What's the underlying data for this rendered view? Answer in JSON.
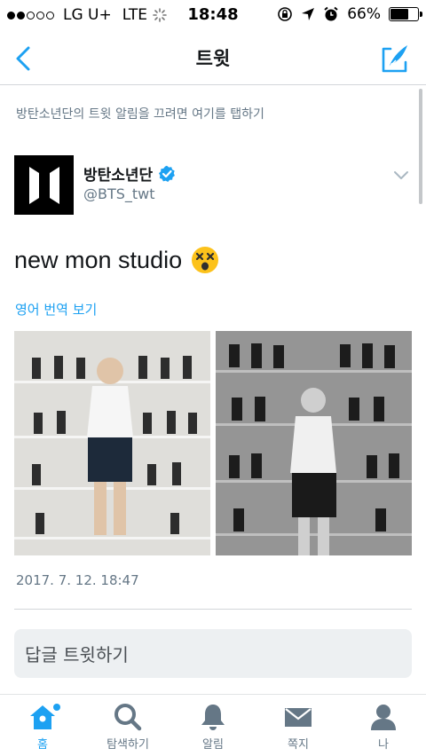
{
  "status_bar": {
    "carrier": "LG U+",
    "network": "LTE",
    "time": "18:48",
    "battery": "66%",
    "battery_level": 0.66,
    "signal_bars_filled": 2
  },
  "nav": {
    "title": "트윗"
  },
  "notification": {
    "text": "방탄소년단의 트윗 알림을 끄려면 여기를 탭하기"
  },
  "tweet": {
    "author_name": "방탄소년단",
    "author_handle": "@BTS_twt",
    "text": "new mon studio",
    "translate_label": "영어 번역 보기",
    "timestamp": "2017. 7. 12. 18:47"
  },
  "reply": {
    "placeholder": "답글 트윗하기"
  },
  "tabs": [
    {
      "label": "홈",
      "icon": "home-icon"
    },
    {
      "label": "탐색하기",
      "icon": "search-icon"
    },
    {
      "label": "알림",
      "icon": "bell-icon"
    },
    {
      "label": "쪽지",
      "icon": "envelope-icon"
    },
    {
      "label": "나",
      "icon": "person-icon"
    }
  ],
  "colors": {
    "accent": "#1da1f2",
    "text": "#14171a",
    "secondary": "#657786",
    "tab_inactive": "#657786"
  }
}
